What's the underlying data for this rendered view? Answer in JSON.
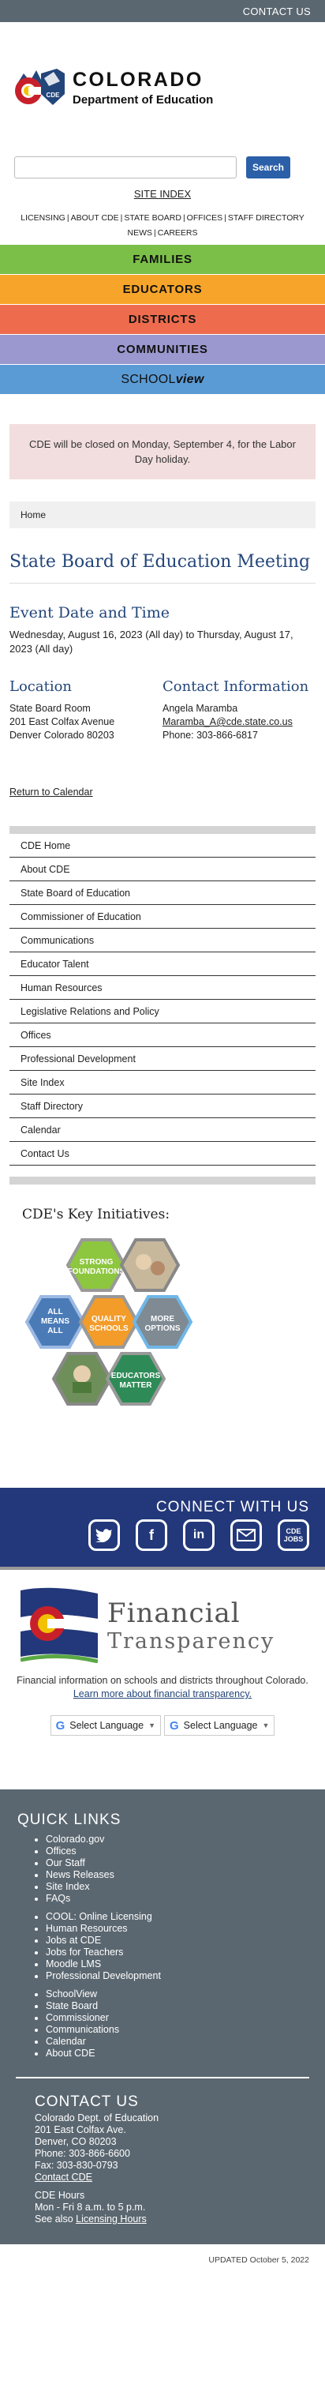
{
  "topbar": {
    "contact_us": "CONTACT US"
  },
  "header": {
    "logo_line1": "COLORADO",
    "logo_line2": "Department of Education",
    "logo_badge": "CDE"
  },
  "search": {
    "placeholder": "",
    "button_label": "Search"
  },
  "site_index": "SITE INDEX",
  "util_links": [
    "LICENSING",
    "ABOUT CDE",
    "STATE BOARD",
    "OFFICES",
    "STAFF DIRECTORY",
    "NEWS",
    "CAREERS"
  ],
  "nav": {
    "families": "FAMILIES",
    "educators": "EDUCATORS",
    "districts": "DISTRICTS",
    "communities": "COMMUNITIES",
    "schoolview_a": "SCHOOL",
    "schoolview_b": "view"
  },
  "alert": "CDE will be closed on Monday, September 4, for the Labor Day holiday.",
  "breadcrumb": "Home",
  "page_title": "State Board of Education Meeting",
  "event": {
    "heading": "Event Date and Time",
    "date": "Wednesday, August 16, 2023 (All day) to Thursday, August 17, 2023 (All day)"
  },
  "location": {
    "heading": "Location",
    "line1": "State Board Room",
    "line2": "201 East Colfax Avenue",
    "line3": "Denver Colorado 80203"
  },
  "contact": {
    "heading": "Contact Information",
    "name": "Angela Maramba",
    "email": "Maramba_A@cde.state.co.us",
    "phone": "Phone: 303-866-6817"
  },
  "return_calendar": "Return to Calendar",
  "side_nav": [
    "CDE Home",
    "About CDE",
    "State Board of Education",
    "Commissioner of Education",
    "Communications",
    "Educator Talent",
    "Human Resources",
    "Legislative Relations and Policy",
    "Offices",
    "Professional Development",
    "Site Index",
    "Staff Directory",
    "Calendar",
    "Contact Us"
  ],
  "initiatives": {
    "heading": "CDE's Key Initiatives:",
    "hex": {
      "strong": [
        "STRONG",
        "FOUNDATIONS"
      ],
      "all": [
        "ALL",
        "MEANS",
        "ALL"
      ],
      "quality": [
        "QUALITY",
        "SCHOOLS"
      ],
      "more": [
        "MORE",
        "OPTIONS"
      ],
      "educators": [
        "EDUCATORS",
        "MATTER"
      ]
    }
  },
  "connect": {
    "title": "CONNECT WITH US",
    "icons": [
      "twitter-icon",
      "facebook-icon",
      "linkedin-icon",
      "email-icon",
      "cde-jobs-icon"
    ],
    "jobs_label": "CDE JOBS"
  },
  "financial": {
    "title_a": "Financial",
    "title_b": "Transparency",
    "text": "Financial information on schools and districts throughout Colorado.",
    "more_link": "Learn more about financial transparency.",
    "select_language": "Select Language"
  },
  "footer": {
    "quick_links_heading": "QUICK LINKS",
    "group1": [
      "Colorado.gov",
      "Offices",
      "Our Staff",
      "News Releases",
      "Site Index",
      "FAQs"
    ],
    "group2": [
      "COOL: Online Licensing",
      "Human Resources",
      "Jobs at CDE",
      "Jobs for Teachers",
      "Moodle LMS",
      "Professional Development"
    ],
    "group3": [
      "SchoolView",
      "State Board",
      "Commissioner",
      "Communications",
      "Calendar",
      "About CDE"
    ],
    "contact_heading": "CONTACT US",
    "contact_lines": [
      "Colorado Dept. of Education",
      "201 East Colfax Ave.",
      "Denver, CO 80203",
      "Phone: 303-866-6600",
      "Fax: 303-830-0793"
    ],
    "contact_link": "Contact CDE",
    "hours_heading": "CDE Hours",
    "hours": "Mon - Fri 8 a.m. to 5 p.m.",
    "see_also": "See also",
    "licensing_hours": "Licensing Hours"
  },
  "updated": "UPDATED October 5, 2022"
}
